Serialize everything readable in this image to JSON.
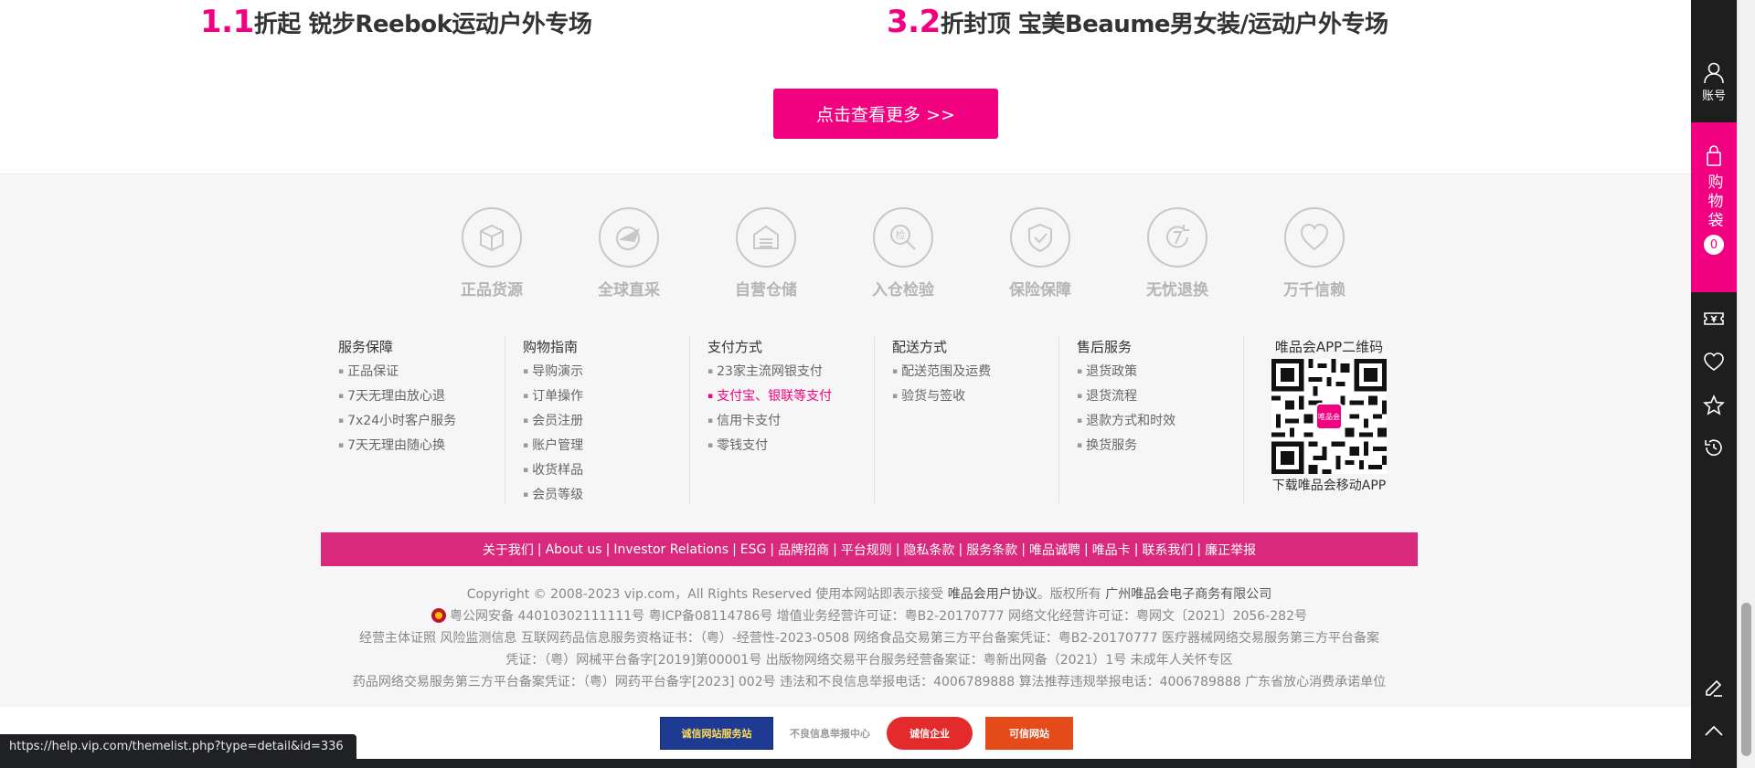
{
  "promos": [
    {
      "discount": "1.1",
      "unit": "折起",
      "title": "锐步Reebok运动户外专场"
    },
    {
      "discount": "3.2",
      "unit": "折封顶",
      "title": "宝美Beaume男女装/运动户外专场"
    }
  ],
  "more_button": "点击查看更多 >>",
  "assurances": [
    {
      "label": "正品货源",
      "icon": "box-icon"
    },
    {
      "label": "全球直采",
      "icon": "globe-plane-icon"
    },
    {
      "label": "自营仓储",
      "icon": "warehouse-icon"
    },
    {
      "label": "入仓检验",
      "icon": "inspection-icon"
    },
    {
      "label": "保险保障",
      "icon": "shield-icon"
    },
    {
      "label": "无忧退换",
      "icon": "seven-day-return-icon"
    },
    {
      "label": "万千信赖",
      "icon": "heart-icon"
    }
  ],
  "footer_columns": [
    {
      "title": "服务保障",
      "items": [
        "正品保证",
        "7天无理由放心退",
        "7x24小时客户服务",
        "7天无理由随心换"
      ]
    },
    {
      "title": "购物指南",
      "items": [
        "导购演示",
        "订单操作",
        "会员注册",
        "账户管理",
        "收货样品",
        "会员等级"
      ]
    },
    {
      "title": "支付方式",
      "items": [
        "23家主流网银支付",
        "支付宝、银联等支付",
        "信用卡支付",
        "零钱支付"
      ]
    },
    {
      "title": "配送方式",
      "items": [
        "配送范围及运费",
        "验货与签收"
      ]
    },
    {
      "title": "售后服务",
      "items": [
        "退货政策",
        "退货流程",
        "退款方式和时效",
        "换货服务"
      ]
    }
  ],
  "qr": {
    "title": "唯品会APP二维码",
    "logo": "唯品会",
    "caption": "下载唯品会移动APP"
  },
  "footer_links": [
    "关于我们",
    "About us",
    "Investor Relations",
    "ESG",
    "品牌招商",
    "平台规则",
    "隐私条款",
    "服务条款",
    "唯品诚聘",
    "唯品卡",
    "联系我们",
    "廉正举报"
  ],
  "legal": {
    "line1_a": "Copyright © 2008-2023 vip.com，All Rights Reserved  使用本网站即表示接受",
    "line1_b": "唯品会用户协议",
    "line1_c": "。版权所有",
    "line1_d": "广州唯品会电子商务有限公司",
    "line2": "粤公网安备 44010302111111号     粤ICP备08114786号 增值业务经营许可证：粤B2-20170777 网络文化经营许可证：粤网文〔2021〕2056-282号",
    "line3": "经营主体证照    风险监测信息    互联网药品信息服务资格证书：（粤）-经营性-2023-0508 网络食品交易第三方平台备案凭证：粤B2-20170777 医疗器械网络交易服务第三方平台备案",
    "line4": "凭证：（粤）网械平台备字[2019]第00001号 出版物网络交易平台服务经营备案证：粤新出网备（2021）1号  未成年人关怀专区",
    "line5": "药品网络交易服务第三方平台备案凭证：（粤）网药平台备字[2023] 002号 违法和不良信息举报电话：4006789888 算法推荐违规举报电话：4006789888 广东省放心消费承诺单位"
  },
  "badges": [
    "诚信网站服务站",
    "不良信息举报中心",
    "诚信企业",
    "可信网站"
  ],
  "status_url": "https://help.vip.com/themelist.php?type=detail&id=336",
  "sidebar": {
    "account_label": "账号",
    "bag_label": "购物袋",
    "bag_count": "0"
  },
  "colors": {
    "brand": "#f10180",
    "link_bar": "#d9297c",
    "sidebar": "#1e1e1e"
  }
}
